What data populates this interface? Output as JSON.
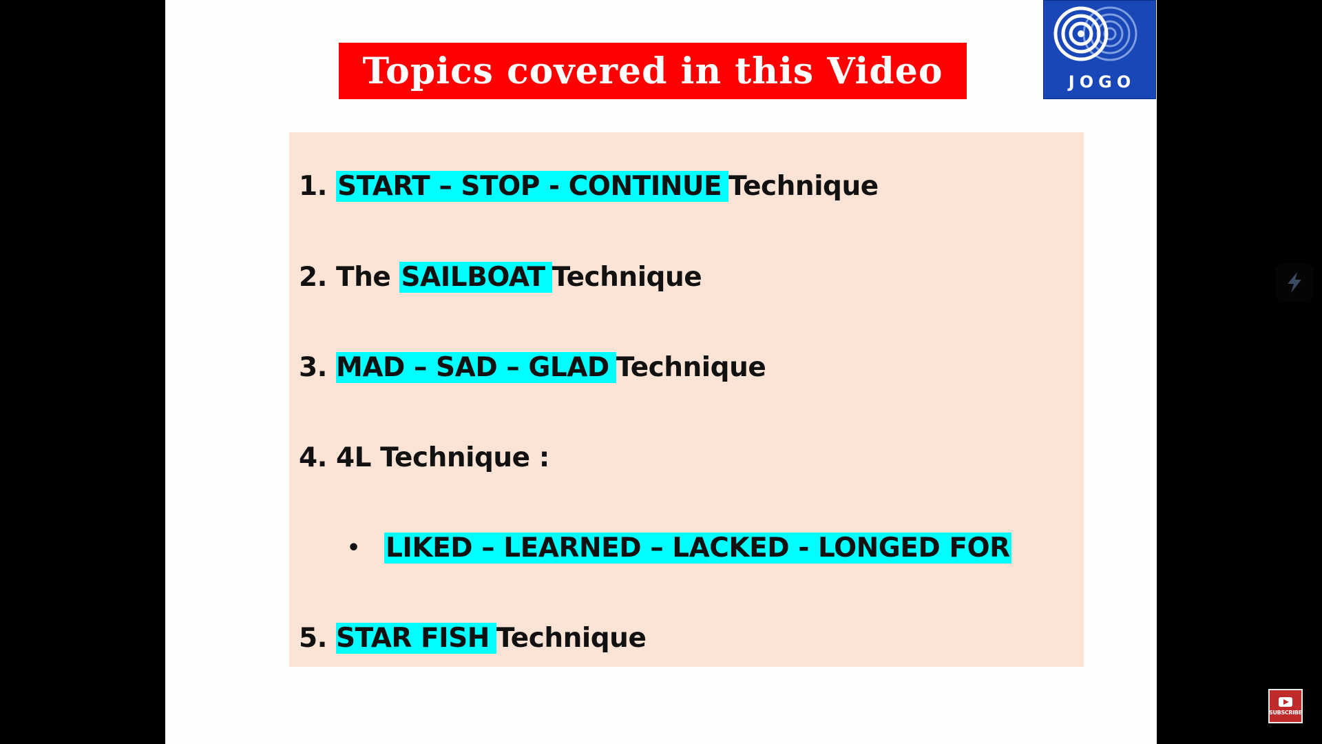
{
  "slide": {
    "title": "Topics covered in this Video",
    "logo_text": "JOGO",
    "items": [
      {
        "number": "1. ",
        "highlight": "START – STOP - CONTINUE",
        "suffix": "Technique"
      },
      {
        "number": "2. The ",
        "highlight": "SAILBOAT",
        "suffix": "Technique"
      },
      {
        "number": "3.  ",
        "highlight": "MAD – SAD – GLAD",
        "suffix": "Technique"
      },
      {
        "number": "4.   ",
        "highlight": "",
        "suffix": "4L Technique :"
      },
      {
        "number": "5.  ",
        "highlight": "STAR FISH",
        "suffix": "Technique"
      }
    ],
    "sub_bullet": {
      "bullet": "•",
      "text": "LIKED – LEARNED – LACKED - LONGED FOR"
    }
  },
  "overlay": {
    "subscribe_label": "SUBSCRIBE",
    "side_icon": "lightning-app-icon"
  },
  "colors": {
    "title_bg": "#ff0000",
    "highlight": "#00ffff",
    "content_bg": "#fbe4d6",
    "logo_bg": "#1a47b8"
  }
}
